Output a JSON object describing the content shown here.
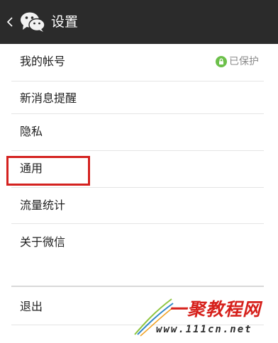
{
  "header": {
    "title": "设置",
    "back_icon": "chevron-left-icon",
    "logo_icon": "wechat-logo-icon",
    "background": "#2b2b2b"
  },
  "settings": {
    "items": [
      {
        "label": "我的帐号",
        "status": "已保护",
        "status_icon": "lock-icon",
        "status_color": "#6cc04a"
      },
      {
        "label": "新消息提醒"
      },
      {
        "label": "隐私"
      },
      {
        "label": "通用"
      },
      {
        "label": "流量统计"
      },
      {
        "label": "关于微信"
      }
    ],
    "logout_label": "退出",
    "highlight_color": "#d4211f"
  },
  "watermark": {
    "name": "一聚教程网",
    "url": "www.111cn.net"
  }
}
